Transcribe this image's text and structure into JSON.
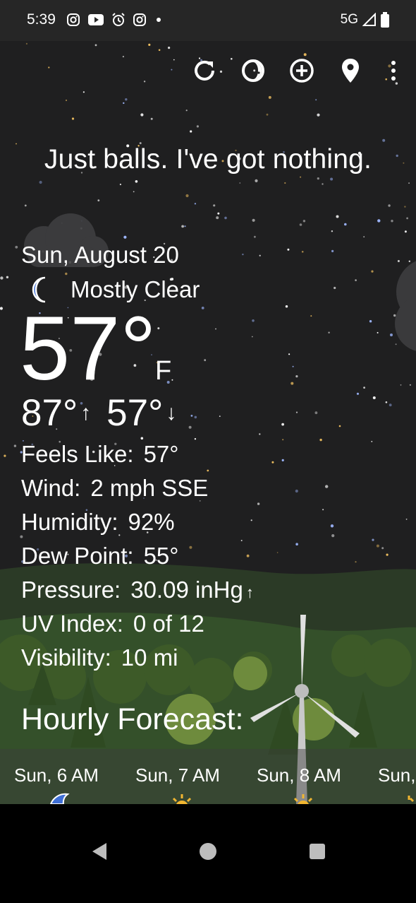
{
  "status_bar": {
    "time": "5:39",
    "network": "5G",
    "icons": [
      "instagram-icon",
      "youtube-icon",
      "alarm-icon",
      "instagram-icon",
      "dot-icon",
      "signal-icon",
      "battery-icon"
    ]
  },
  "toolbar": {
    "icons": [
      "refresh-icon",
      "theme-icon",
      "add-location-icon",
      "location-pin-icon",
      "more-options-icon"
    ]
  },
  "quote": "Just balls. I've got nothing.",
  "current": {
    "date": "Sun, August 20",
    "condition": "Mostly Clear",
    "condition_icon": "moon-icon",
    "temp": "57°",
    "unit": "F",
    "high": "87°",
    "low": "57°"
  },
  "details": [
    {
      "label": "Feels Like:",
      "value": "57°"
    },
    {
      "label": "Wind:",
      "value": "2 mph SSE"
    },
    {
      "label": "Humidity:",
      "value": "92%"
    },
    {
      "label": "Dew Point:",
      "value": "55°"
    },
    {
      "label": "Pressure:",
      "value": "30.09 inHg"
    },
    {
      "label": "UV Index:",
      "value": "0 of 12"
    },
    {
      "label": "Visibility:",
      "value": "10 mi"
    }
  ],
  "pressure_trend": "rising",
  "hourly": {
    "title": "Hourly Forecast:",
    "items": [
      {
        "label": "Sun, 6 AM",
        "icon": "moon-icon"
      },
      {
        "label": "Sun, 7 AM",
        "icon": "sun-icon"
      },
      {
        "label": "Sun, 8 AM",
        "icon": "sun-icon"
      },
      {
        "label": "Sun,",
        "icon": "sun-icon"
      }
    ]
  },
  "colors": {
    "sky": "#1f1f20",
    "moon": "#3f6fd6",
    "sun": "#f1b631",
    "grass": "#3e6b2c"
  }
}
